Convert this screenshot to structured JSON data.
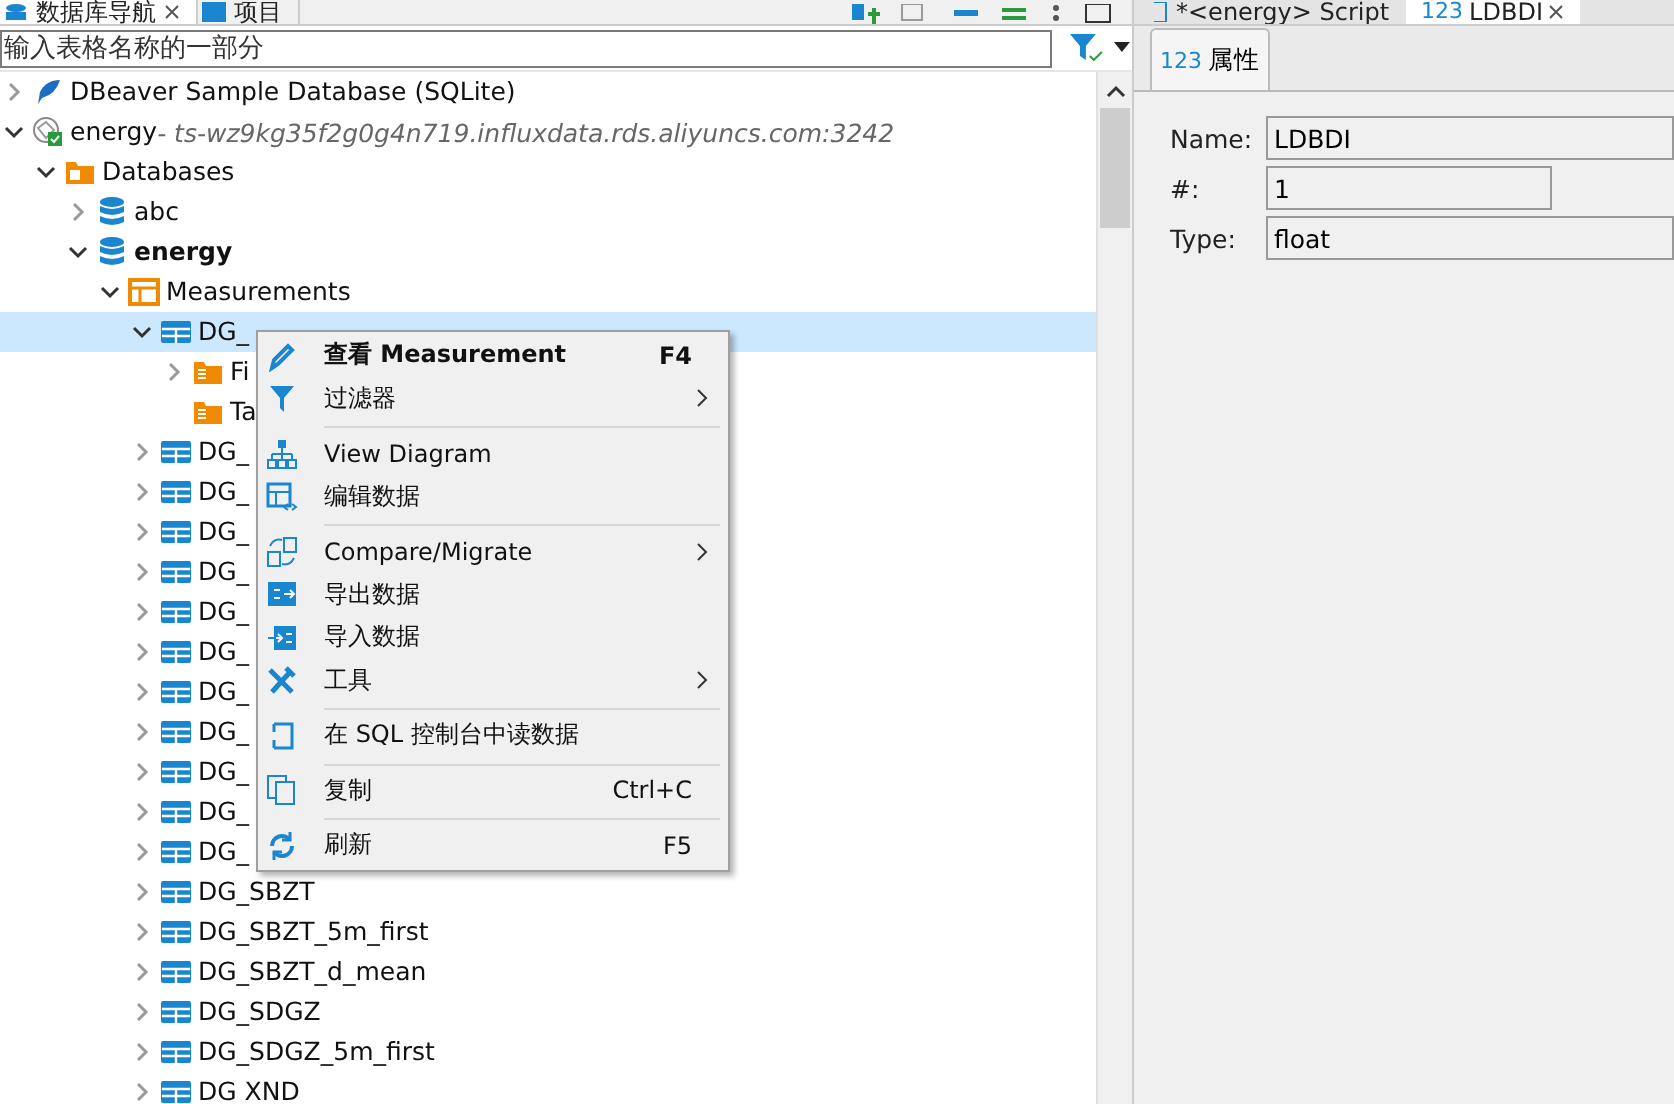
{
  "left_tabs": [
    {
      "label": "数据库导航",
      "selected": true,
      "closable": true
    },
    {
      "label": "项目",
      "selected": false,
      "closable": false
    }
  ],
  "search": {
    "placeholder": "输入表格名称的一部分"
  },
  "tree": [
    {
      "label": "DBeaver Sample Database (SQLite)",
      "kind": "sqlite",
      "expanded": false,
      "selected": false
    },
    {
      "label": "energy",
      "detail": " - ts-wz9kg35f2g0g4n719.influxdata.rds.aliyuncs.com:3242",
      "kind": "connection",
      "expanded": true,
      "selected": false,
      "children": [
        {
          "label": "Databases",
          "kind": "folder",
          "expanded": true,
          "selected": false,
          "children": [
            {
              "label": "abc",
              "kind": "database",
              "expanded": false,
              "selected": false
            },
            {
              "label": "energy",
              "kind": "database",
              "bold": true,
              "expanded": true,
              "selected": false,
              "children": [
                {
                  "label": "Measurements",
                  "kind": "measurements",
                  "expanded": true,
                  "selected": false,
                  "children": [
                    {
                      "label": "DG_",
                      "kind": "table",
                      "expanded": true,
                      "selected": true,
                      "children": [
                        {
                          "label": "Fi",
                          "kind": "subfolder",
                          "expanded": false,
                          "selected": false
                        },
                        {
                          "label": "Ta",
                          "kind": "subfolder",
                          "selected": false
                        }
                      ]
                    },
                    {
                      "label": "DG_",
                      "kind": "table",
                      "expanded": false,
                      "selected": false
                    },
                    {
                      "label": "DG_",
                      "kind": "table",
                      "expanded": false,
                      "selected": false
                    },
                    {
                      "label": "DG_",
                      "kind": "table",
                      "expanded": false,
                      "selected": false
                    },
                    {
                      "label": "DG_",
                      "kind": "table",
                      "expanded": false,
                      "selected": false
                    },
                    {
                      "label": "DG_",
                      "kind": "table",
                      "expanded": false,
                      "selected": false
                    },
                    {
                      "label": "DG_",
                      "kind": "table",
                      "expanded": false,
                      "selected": false
                    },
                    {
                      "label": "DG_",
                      "kind": "table",
                      "expanded": false,
                      "selected": false
                    },
                    {
                      "label": "DG_",
                      "kind": "table",
                      "expanded": false,
                      "selected": false
                    },
                    {
                      "label": "DG_",
                      "kind": "table",
                      "expanded": false,
                      "selected": false
                    },
                    {
                      "label": "DG_",
                      "kind": "table",
                      "expanded": false,
                      "selected": false
                    },
                    {
                      "label": "DG_",
                      "kind": "table",
                      "expanded": false,
                      "selected": false
                    },
                    {
                      "label": "DG_SBZT",
                      "kind": "table",
                      "expanded": false,
                      "selected": false
                    },
                    {
                      "label": "DG_SBZT_5m_first",
                      "kind": "table",
                      "expanded": false,
                      "selected": false
                    },
                    {
                      "label": "DG_SBZT_d_mean",
                      "kind": "table",
                      "expanded": false,
                      "selected": false
                    },
                    {
                      "label": "DG_SDGZ",
                      "kind": "table",
                      "expanded": false,
                      "selected": false
                    },
                    {
                      "label": "DG_SDGZ_5m_first",
                      "kind": "table",
                      "expanded": false,
                      "selected": false
                    },
                    {
                      "label": "DG XND",
                      "kind": "table",
                      "expanded": false,
                      "selected": false
                    }
                  ]
                }
              ]
            }
          ]
        }
      ]
    }
  ],
  "context_menu": [
    {
      "kind": "item",
      "label": "查看 Measurement",
      "bold": true,
      "shortcut": "F4",
      "submenu": false
    },
    {
      "kind": "item",
      "label": "过滤器",
      "bold": false,
      "submenu": true
    },
    {
      "kind": "separator"
    },
    {
      "kind": "item",
      "label": "View Diagram",
      "bold": false,
      "submenu": false
    },
    {
      "kind": "item",
      "label": "编辑数据",
      "bold": false,
      "submenu": false
    },
    {
      "kind": "separator"
    },
    {
      "kind": "item",
      "label": "Compare/Migrate",
      "bold": false,
      "submenu": true
    },
    {
      "kind": "item",
      "label": "导出数据",
      "bold": false,
      "submenu": false
    },
    {
      "kind": "item",
      "label": "导入数据",
      "bold": false,
      "submenu": false
    },
    {
      "kind": "item",
      "label": "工具",
      "bold": false,
      "submenu": true
    },
    {
      "kind": "separator"
    },
    {
      "kind": "item",
      "label": "在 SQL 控制台中读数据",
      "bold": false,
      "submenu": false
    },
    {
      "kind": "separator"
    },
    {
      "kind": "item",
      "label": "复制",
      "shortcut": "Ctrl+C",
      "bold": false,
      "submenu": false
    },
    {
      "kind": "separator"
    },
    {
      "kind": "item",
      "label": "刷新",
      "shortcut": "F5",
      "bold": false,
      "submenu": false
    }
  ],
  "editor_tabs": [
    {
      "kind": "script",
      "label": "*<energy> Script",
      "selected": false,
      "closable": false
    },
    {
      "kind": "column",
      "badge": "123",
      "label": "LDBDI",
      "selected": true,
      "closable": true
    }
  ],
  "sub_tabs": [
    {
      "badge": "123",
      "label": "属性",
      "selected": true
    }
  ],
  "properties": [
    {
      "label": "Name:",
      "value": "LDBDI",
      "wide": true
    },
    {
      "label": "#:",
      "value": "1",
      "wide": false
    },
    {
      "label": "Type:",
      "value": "float",
      "wide": true
    }
  ]
}
